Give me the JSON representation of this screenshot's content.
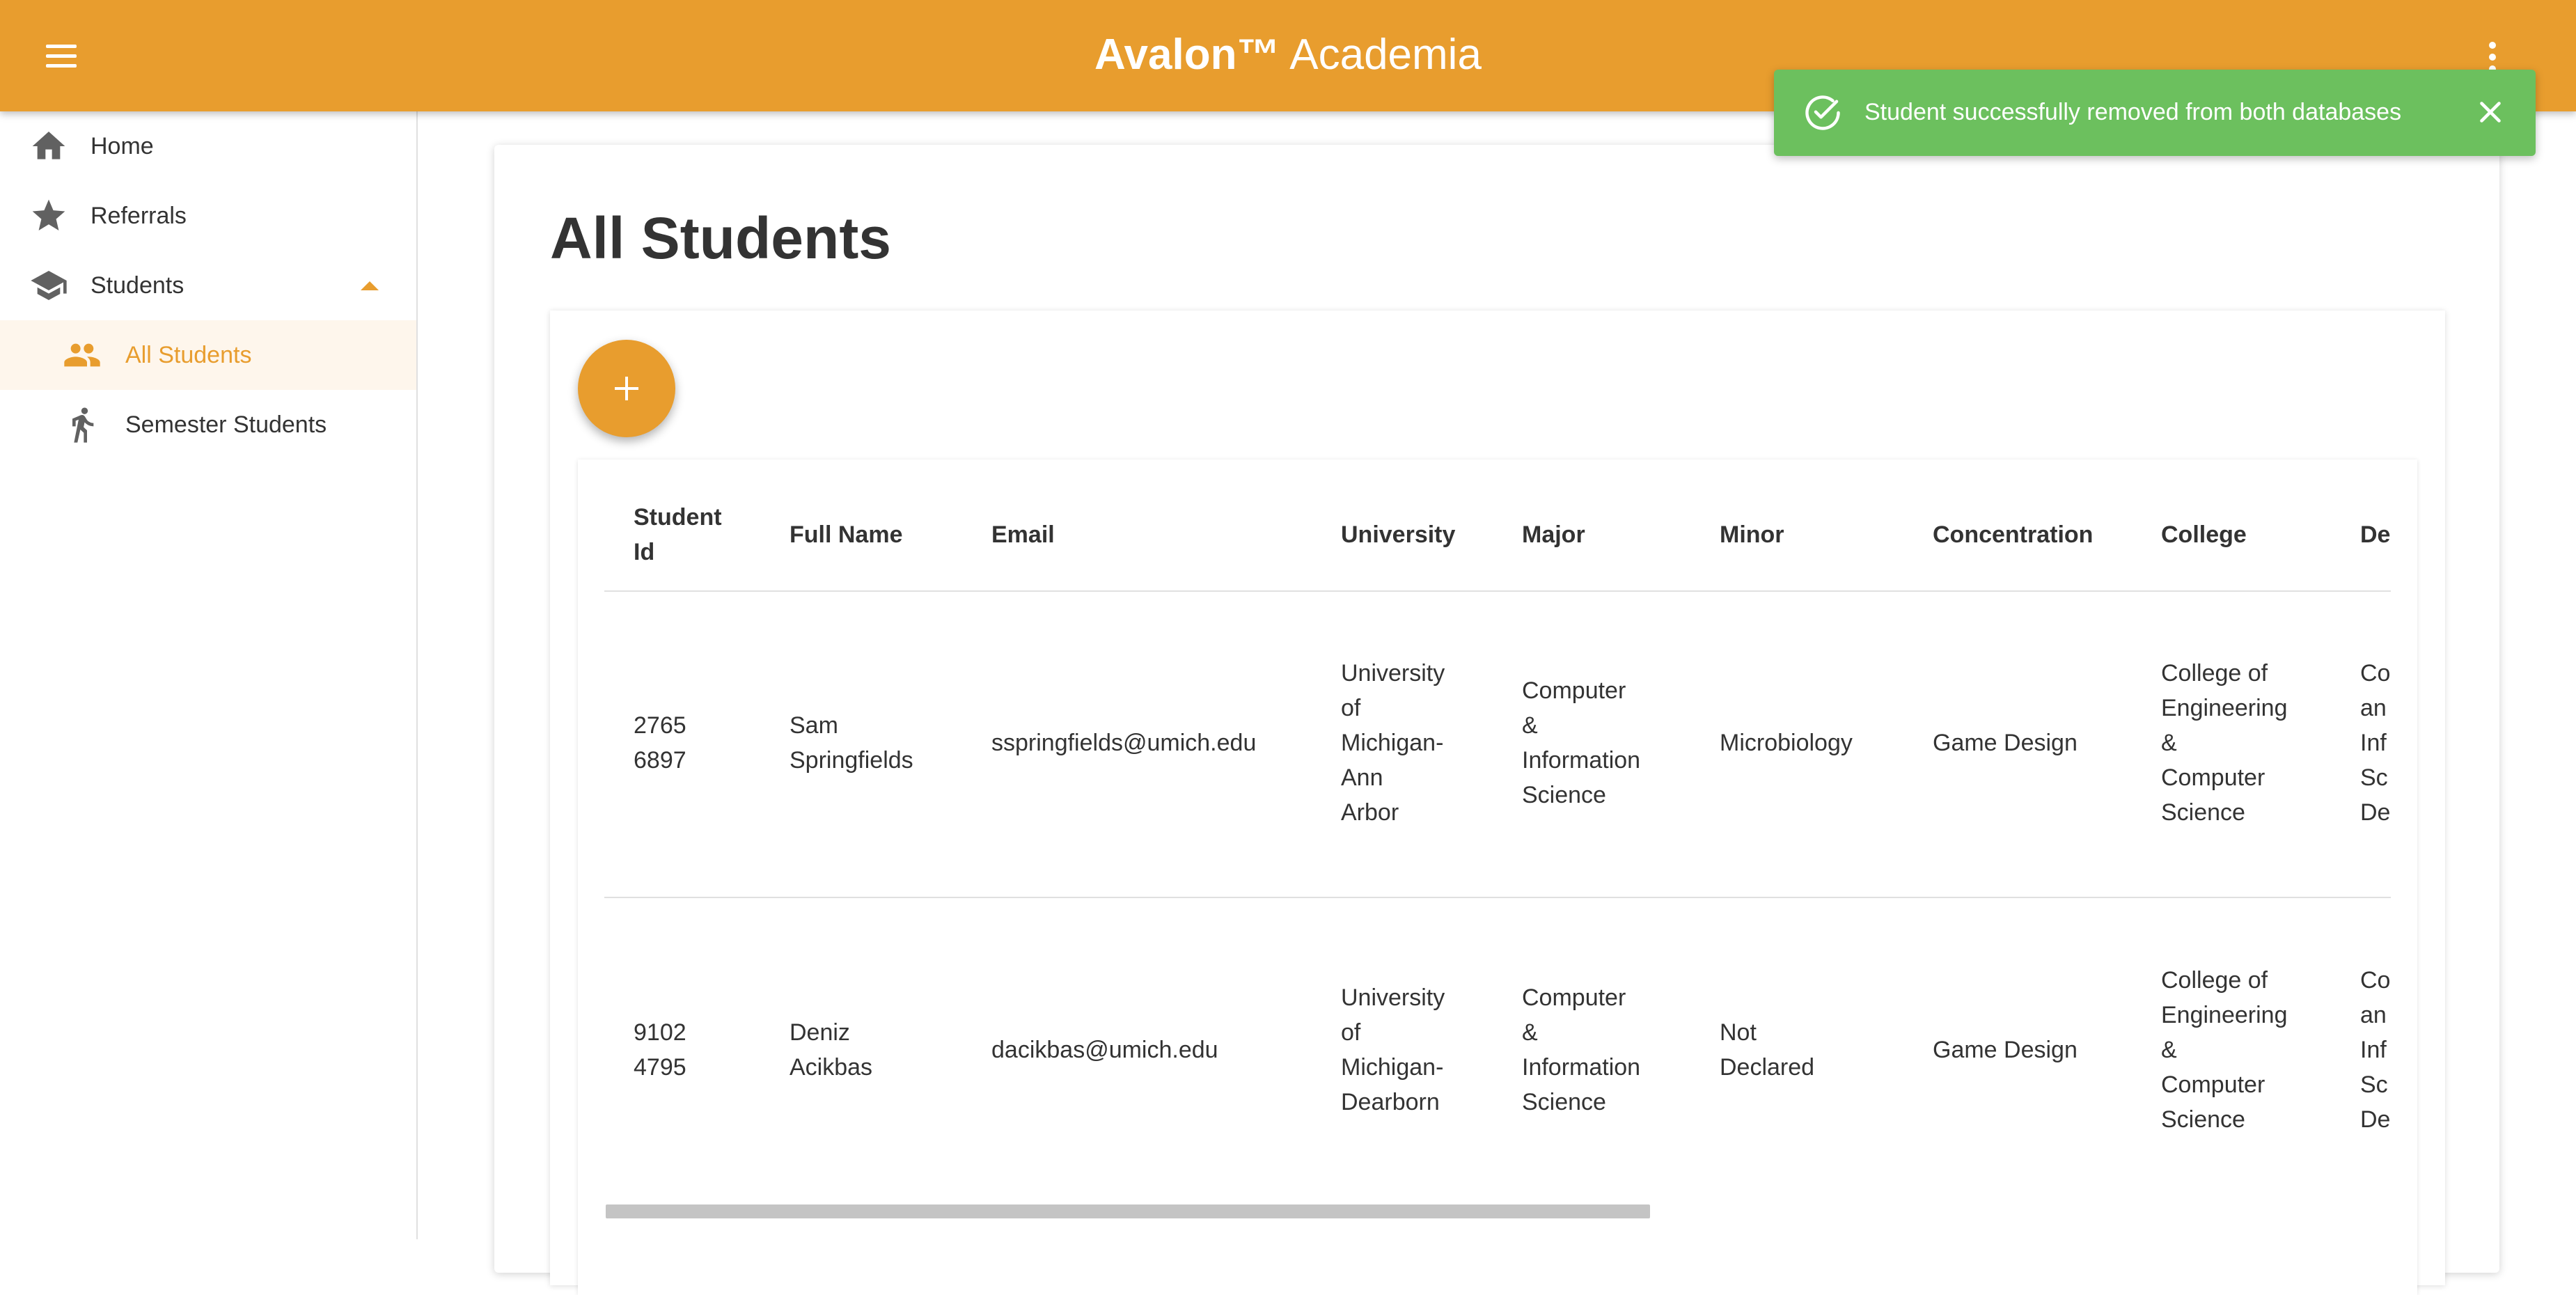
{
  "app": {
    "brand_bold": "Avalon™",
    "brand_light": " Academia",
    "menu_icon": "hamburger-menu-icon",
    "more_icon": "more-vert-icon",
    "accent_color": "#E89D2E"
  },
  "sidebar": {
    "items": [
      {
        "label": "Home",
        "icon": "home-icon"
      },
      {
        "label": "Referrals",
        "icon": "star-icon"
      },
      {
        "label": "Students",
        "icon": "school-icon",
        "expanded": true
      },
      {
        "label": "All Students",
        "icon": "people-icon",
        "active": true
      },
      {
        "label": "Semester Students",
        "icon": "walking-person-icon"
      }
    ]
  },
  "main": {
    "title": "All Students",
    "add_icon": "plus-icon"
  },
  "table": {
    "headers": {
      "student_id_1": "Student",
      "student_id_2": "Id",
      "full_name": "Full Name",
      "email": "Email",
      "university": "University",
      "major": "Major",
      "minor": "Minor",
      "concentration": "Concentration",
      "college": "College",
      "department": "De"
    },
    "rows": [
      {
        "id_1": "2765",
        "id_2": "6897",
        "name_1": "Sam",
        "name_2": "Springfields",
        "email": "sspringfields@umich.edu",
        "uni_1": "University",
        "uni_2": "of",
        "uni_3": "Michigan-",
        "uni_4": "Ann",
        "uni_5": "Arbor",
        "major_1": "Computer",
        "major_2": "&",
        "major_3": "Information",
        "major_4": "Science",
        "minor_1": "Microbiology",
        "minor_2": "",
        "concentration": "Game Design",
        "college_1": "College of",
        "college_2": "Engineering",
        "college_3": "&",
        "college_4": "Computer",
        "college_5": "Science",
        "dept_1": "Co",
        "dept_2": "an",
        "dept_3": "Inf",
        "dept_4": "Sc",
        "dept_5": "De"
      },
      {
        "id_1": "9102",
        "id_2": "4795",
        "name_1": "Deniz",
        "name_2": "Acikbas",
        "email": "dacikbas@umich.edu",
        "uni_1": "University",
        "uni_2": "of",
        "uni_3": "Michigan-",
        "uni_4": "Dearborn",
        "uni_5": "",
        "major_1": "Computer",
        "major_2": "&",
        "major_3": "Information",
        "major_4": "Science",
        "minor_1": "Not",
        "minor_2": "Declared",
        "concentration": "Game Design",
        "college_1": "College of",
        "college_2": "Engineering",
        "college_3": "&",
        "college_4": "Computer",
        "college_5": "Science",
        "dept_1": "Co",
        "dept_2": "an",
        "dept_3": "Inf",
        "dept_4": "Sc",
        "dept_5": "De"
      }
    ]
  },
  "toast": {
    "message": "Student successfully removed from both databases",
    "icon": "check-circle-icon",
    "close_icon": "close-icon",
    "color": "#6CC05E"
  }
}
